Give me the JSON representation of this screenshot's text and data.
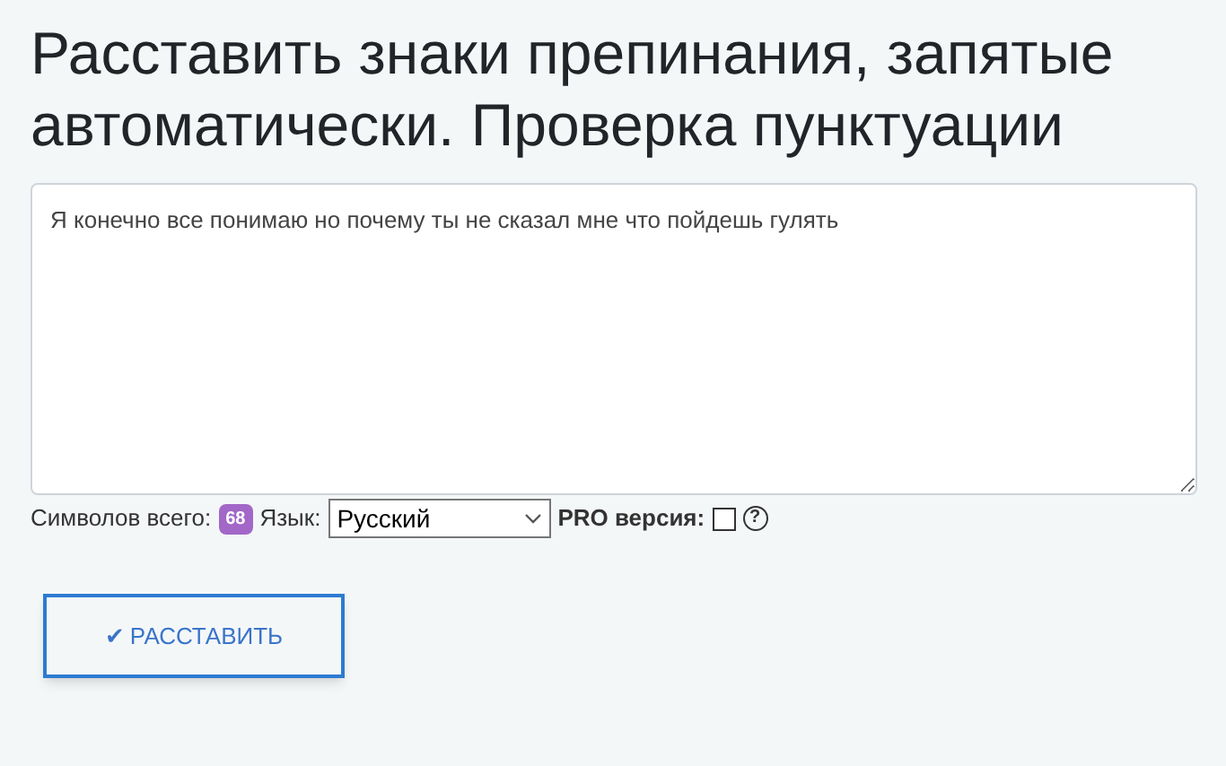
{
  "title": "Расставить знаки препинания, запятые автоматически. Проверка пунктуации",
  "text_area": {
    "value": "Я конечно все понимаю но почему ты не сказал мне что пойдешь гулять"
  },
  "stats": {
    "count_label": "Символов всего:",
    "count": "68",
    "language_label": "Язык:",
    "language": "Русский",
    "pro_label": "PRO версия:",
    "pro_checked": false,
    "help": "?"
  },
  "submit_button": {
    "icon": "✔",
    "label": "РАССТАВИТЬ"
  }
}
